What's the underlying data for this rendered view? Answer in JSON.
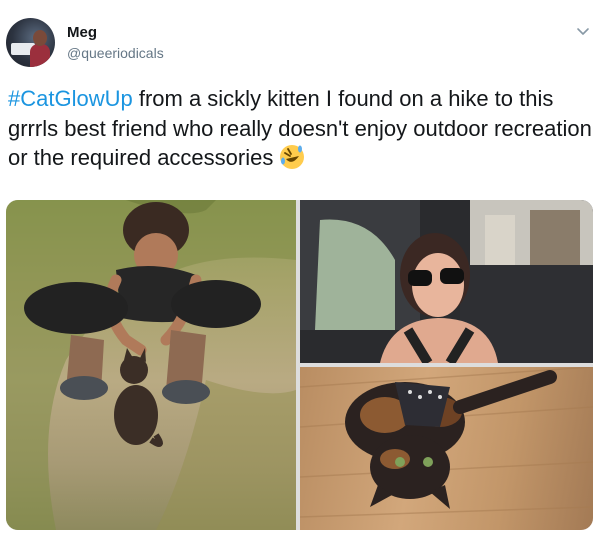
{
  "author": {
    "name": "Meg",
    "handle": "@queeriodicals"
  },
  "tweet": {
    "hashtag": "#CatGlowUp",
    "text": " from a sickly kitten I found on a hike to this grrrls best friend who really doesn't enjoy outdoor recreation or the required accessories ",
    "emoji": "rolling-on-floor-laughing-emoji"
  },
  "media": {
    "count": 3,
    "photos": [
      "woman crouching with kitten on a trail",
      "woman in sunglasses in a car",
      "cat lying upside down on wood floor wearing a harness"
    ]
  },
  "colors": {
    "hashtag": "#1b95e0",
    "text": "#14171a",
    "secondary": "#657786"
  }
}
